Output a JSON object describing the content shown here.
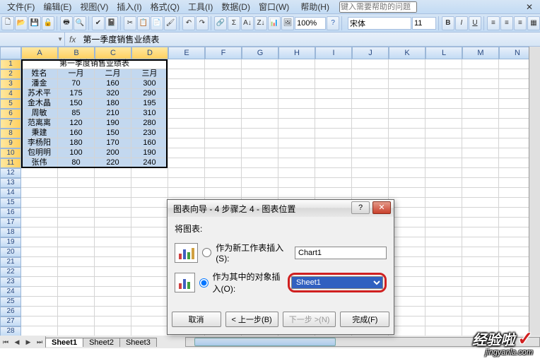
{
  "menu": {
    "file": "文件(F)",
    "edit": "编辑(E)",
    "view": "视图(V)",
    "insert": "插入(I)",
    "format": "格式(Q)",
    "tools": "工具(I)",
    "data": "数据(D)",
    "window": "窗口(W)",
    "help": "帮助(H)",
    "ask_placeholder": "键入需要帮助的问题"
  },
  "toolbar": {
    "zoom": "100%",
    "font": "宋体",
    "size": "11"
  },
  "formula": {
    "cell_ref": "",
    "value": "第一季度销售业绩表"
  },
  "cols": [
    "A",
    "B",
    "C",
    "D",
    "E",
    "F",
    "G",
    "H",
    "I",
    "J",
    "K",
    "L",
    "M",
    "N"
  ],
  "table": {
    "title": "第一季度销售业绩表",
    "headers": [
      "姓名",
      "一月",
      "二月",
      "三月"
    ],
    "rows": [
      [
        "潘金",
        "70",
        "160",
        "300"
      ],
      [
        "苏术平",
        "175",
        "320",
        "290"
      ],
      [
        "金木晶",
        "150",
        "180",
        "195"
      ],
      [
        "周敏",
        "85",
        "210",
        "310"
      ],
      [
        "范离离",
        "120",
        "190",
        "280"
      ],
      [
        "秉建",
        "160",
        "150",
        "230"
      ],
      [
        "李杨阳",
        "180",
        "170",
        "160"
      ],
      [
        "包明明",
        "100",
        "200",
        "190"
      ],
      [
        "张伟",
        "80",
        "220",
        "240"
      ]
    ]
  },
  "dialog": {
    "title": "图表向导 - 4 步骤之 4 - 图表位置",
    "group_label": "将图表:",
    "opt1_label": "作为新工作表插入(S):",
    "opt1_value": "Chart1",
    "opt2_label": "作为其中的对象插入(O):",
    "opt2_value": "Sheet1",
    "btn_cancel": "取消",
    "btn_back": "< 上一步(B)",
    "btn_next": "下一步 >(N)",
    "btn_finish": "完成(F)"
  },
  "sheets": {
    "s1": "Sheet1",
    "s2": "Sheet2",
    "s3": "Sheet3"
  },
  "watermark": {
    "cn": "经验啦",
    "en": "jingyanla.com"
  }
}
